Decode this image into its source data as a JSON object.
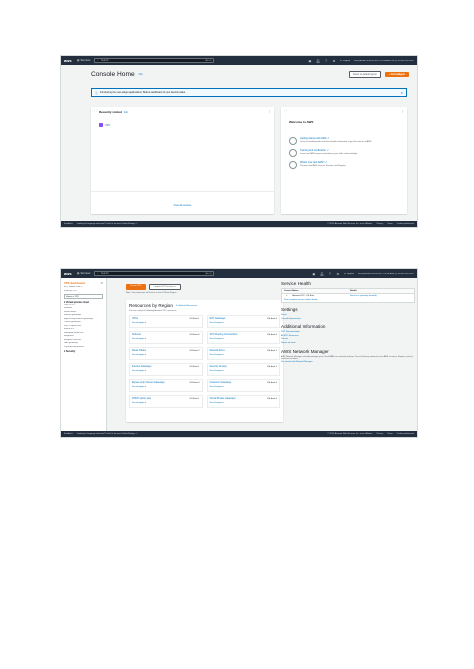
{
  "shot1": {
    "topbar": {
      "logo": "aws",
      "services": "Services",
      "search_placeholder": "Search",
      "search_shortcut": "[Alt+S]",
      "region": "N. Virginia",
      "account": "usr@docker-STATION-PC-VPNLAND-SG @ 6798-4703-9107",
      "icons": [
        "cloudshell-icon",
        "bell-icon",
        "help-icon",
        "settings-icon"
      ]
    },
    "header": {
      "title": "Console Home",
      "info": "Info",
      "reset_button": "Reset to default layout",
      "add_widgets_button": "+ Add widgets"
    },
    "banner": {
      "text": "Introducing the new widget applications: Build a dashboard of your favorite tasks."
    },
    "recently_visited": {
      "title": "Recently visited",
      "info": "Info",
      "items": [
        {
          "label": "VPC"
        }
      ],
      "view_all": "View all services"
    },
    "welcome": {
      "title": "Welcome to AWS",
      "items": [
        {
          "link": "Getting started with AWS ↗",
          "desc": "Learn the fundamentals and find valuable information to get the most out of AWS."
        },
        {
          "link": "Training and certification ↗",
          "desc": "Learn from AWS experts and advance your skills and knowledge."
        },
        {
          "link": "What's new with AWS? ↗",
          "desc": "Discover new AWS services, features, and Regions."
        }
      ]
    },
    "footer": {
      "feedback": "Feedback",
      "language": "Looking for language selection? Find it in the new Unified Settings ↗",
      "copyright": "© 2023, Amazon Web Services, Inc. or its affiliates.",
      "privacy": "Privacy",
      "terms": "Terms",
      "cookies": "Cookie preferences"
    }
  },
  "shot2": {
    "topbar": {
      "logo": "aws",
      "services": "Services",
      "search_placeholder": "Search",
      "search_shortcut": "[Alt+S]",
      "region": "N. Virginia",
      "account": "usr@docker-STATION-PC-VPNLAND @ 6798-4703-9107",
      "icons": [
        "cloudshell-icon",
        "bell-icon",
        "help-icon",
        "settings-icon"
      ]
    },
    "sidenav": {
      "title": "VPC dashboard",
      "ec2_global_view": "EC2 Global View ↗",
      "filter_label": "Filter by VPC:",
      "filter_value": "Select a VPC",
      "group": "Virtual private cloud",
      "items": [
        "Your VPCs",
        "Subnets",
        "Route tables",
        "Internet gateways",
        "Egress-only internet gateways",
        "Carrier gateways",
        "DHCP option sets",
        "Elastic IPs",
        "Managed prefix lists",
        "Endpoints",
        "Endpoint services",
        "NAT gateways",
        "Peering connections"
      ],
      "security_group": "Security"
    },
    "tabs": {
      "create_vpc": "Create VPC",
      "launch_ec2": "Launch EC2 Instances"
    },
    "region_note": "Note: Your Instances will launch in the US East Region.",
    "resources": {
      "title": "Resources by Region",
      "refresh": "⟳ Refresh Resources",
      "subtitle": "You are using the following Amazon VPC resources",
      "cells": [
        {
          "name": "VPCs",
          "count": "US East 1",
          "link": "See all regions ▾"
        },
        {
          "name": "NAT Gateways",
          "count": "US East 0",
          "link": "See all regions ▾"
        },
        {
          "name": "Subnets",
          "count": "US East 6",
          "link": "See all regions ▾"
        },
        {
          "name": "VPC Peering Connections",
          "count": "US East 0",
          "link": "See all regions ▾"
        },
        {
          "name": "Route Tables",
          "count": "US East 2",
          "link": "See all regions ▾"
        },
        {
          "name": "Network ACLs",
          "count": "US East 1",
          "link": "See all regions ▾"
        },
        {
          "name": "Internet Gateways",
          "count": "US East 1",
          "link": "See all regions ▾"
        },
        {
          "name": "Security Groups",
          "count": "US East 1",
          "link": "See all regions ▾"
        },
        {
          "name": "Egress-only Internet Gateways",
          "count": "US East 0",
          "link": "See all regions ▾"
        },
        {
          "name": "Customer Gateways",
          "count": "US East 0",
          "link": "See all regions ▾"
        },
        {
          "name": "DHCP option sets",
          "count": "US East 1",
          "link": "See all regions ▾"
        },
        {
          "name": "Virtual Private Gateways",
          "count": "US East 0",
          "link": "See all regions ▾"
        }
      ]
    },
    "service_health": {
      "title": "Service Health",
      "col_status": "Current Status",
      "col_details": "Details",
      "status": "Amazon EC2 - US East",
      "details": "Service is operating normally",
      "link": "View complete service health details"
    },
    "settings": {
      "title": "Settings",
      "links": [
        "Zones",
        "Console Experiments"
      ]
    },
    "additional": {
      "title": "Additional Information",
      "links": [
        "VPC Documentation",
        "All VPC Resources",
        "Forums",
        "Report an Issue"
      ]
    },
    "network_manager": {
      "title": "AWS Network Manager",
      "desc": "AWS Network Manager centrally manages your Cloud WAN core network and your Transit Gateway network across AWS accounts, Regions, and on-premises locations.",
      "link": "Get started with Network Manager"
    },
    "footer": {
      "feedback": "Feedback",
      "language": "Looking for language selection? Find it in the new Unified Settings ↗",
      "copyright": "© 2023, Amazon Web Services, Inc. or its affiliates.",
      "privacy": "Privacy",
      "terms": "Terms",
      "cookies": "Cookie preferences"
    }
  }
}
